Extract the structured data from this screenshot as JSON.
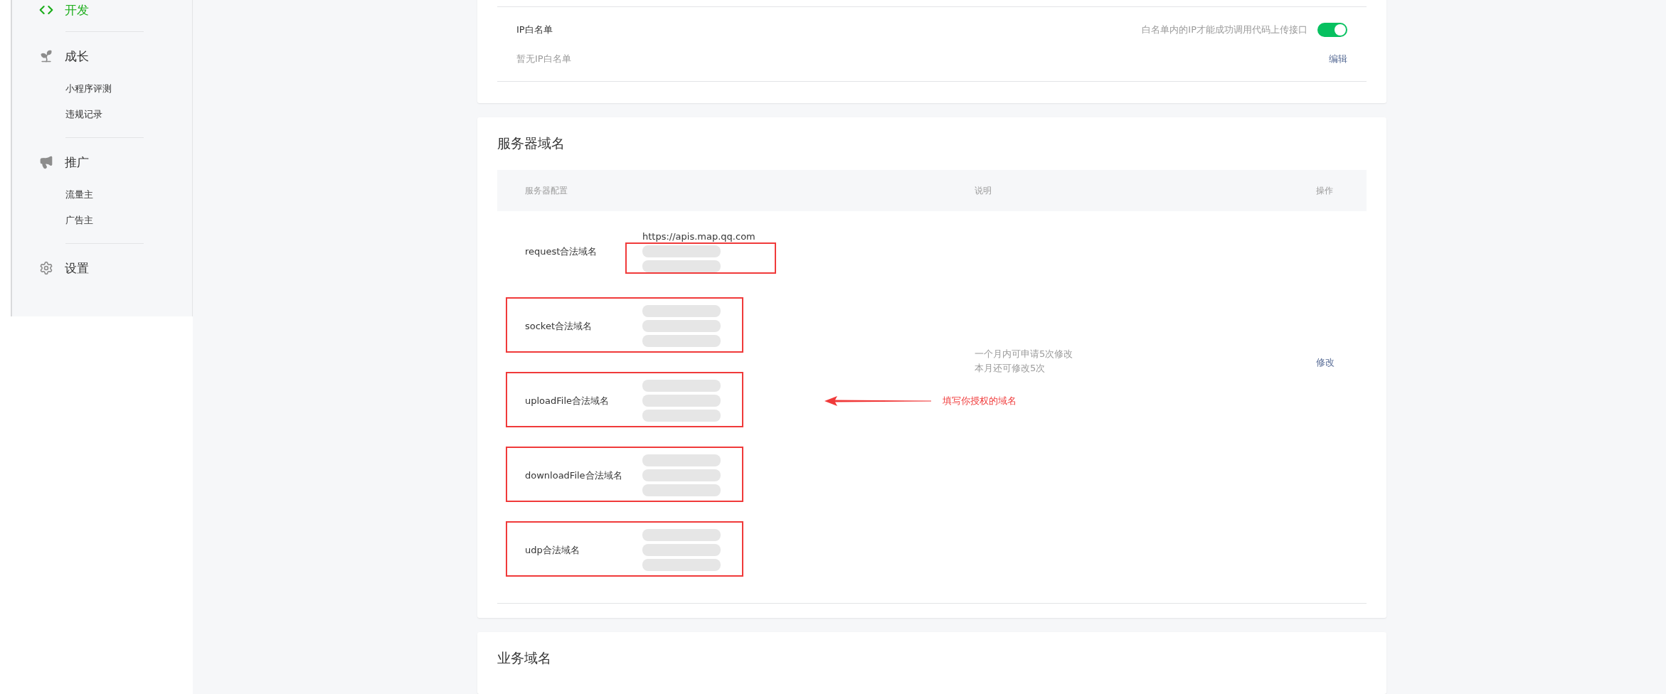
{
  "sidebar": {
    "items": [
      {
        "label": "开发",
        "selected": true
      },
      {
        "label": "成长",
        "selected": false,
        "children": [
          {
            "label": "小程序评测"
          },
          {
            "label": "违规记录"
          }
        ]
      },
      {
        "label": "推广",
        "selected": false,
        "children": [
          {
            "label": "流量主"
          },
          {
            "label": "广告主"
          }
        ]
      },
      {
        "label": "设置",
        "selected": false
      }
    ]
  },
  "ip_whitelist": {
    "title": "IP白名单",
    "hint": "白名单内的IP才能成功调用代码上传接口",
    "on": true,
    "status": "暂无IP白名单",
    "action": "编辑"
  },
  "server_domains": {
    "title": "服务器域名",
    "columns": [
      "服务器配置",
      "说明",
      "操作"
    ],
    "rows": [
      {
        "label": "request合法域名",
        "kind": "values",
        "values": [
          {
            "kind": "text",
            "text": "https://apis.map.qq.com"
          },
          {
            "kind": "blurred"
          },
          {
            "kind": "blurred"
          }
        ]
      },
      {
        "label": "socket合法域名",
        "kind": "row",
        "values": [
          {
            "kind": "blurred"
          },
          {
            "kind": "blurred"
          },
          {
            "kind": "blurred"
          }
        ]
      },
      {
        "label": "uploadFile合法域名",
        "kind": "row",
        "values": [
          {
            "kind": "blurred"
          },
          {
            "kind": "blurred"
          },
          {
            "kind": "blurred"
          }
        ]
      },
      {
        "label": "downloadFile合法域名",
        "kind": "row",
        "values": [
          {
            "kind": "blurred"
          },
          {
            "kind": "blurred"
          },
          {
            "kind": "blurred"
          }
        ]
      },
      {
        "label": "udp合法域名",
        "kind": "row",
        "values": [
          {
            "kind": "blurred"
          },
          {
            "kind": "blurred"
          },
          {
            "kind": "blurred"
          }
        ]
      }
    ],
    "notes": [
      "一个月内可申请5次修改",
      "本月还可修改5次"
    ],
    "action": "修改",
    "callout": "填写你授权的域名"
  },
  "business_domains": {
    "title": "业务域名"
  }
}
